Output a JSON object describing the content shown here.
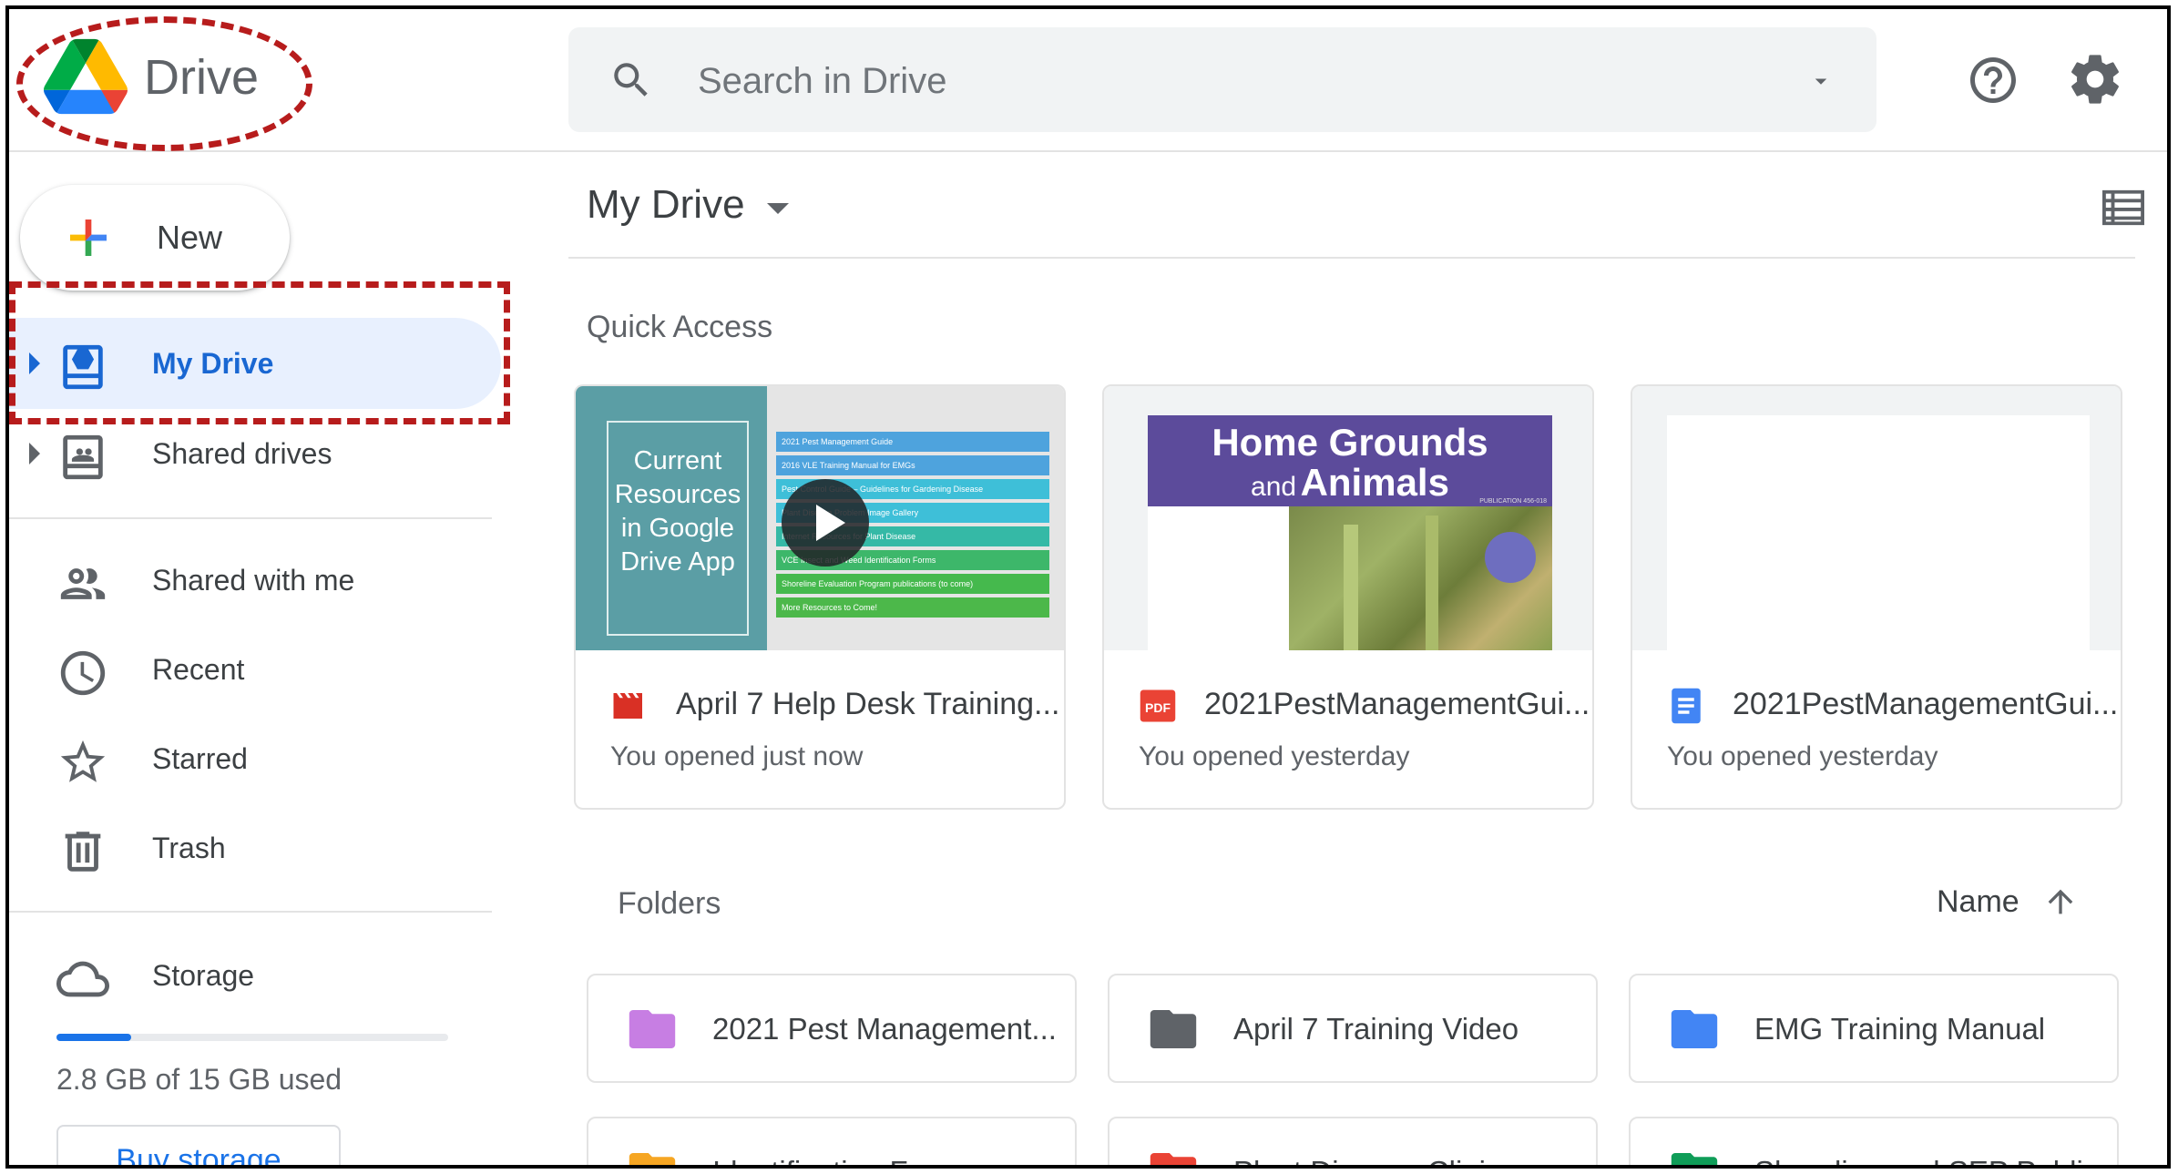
{
  "app": {
    "title": "Drive"
  },
  "search": {
    "placeholder": "Search in Drive"
  },
  "new_button": {
    "label": "New"
  },
  "nav": [
    {
      "label": "My Drive",
      "icon": "my-drive-icon",
      "active": true
    },
    {
      "label": "Shared drives",
      "icon": "shared-drives-icon"
    },
    {
      "label": "Shared with me",
      "icon": "people-icon"
    },
    {
      "label": "Recent",
      "icon": "clock-icon"
    },
    {
      "label": "Starred",
      "icon": "star-icon"
    },
    {
      "label": "Trash",
      "icon": "trash-icon"
    },
    {
      "label": "Storage",
      "icon": "cloud-icon"
    }
  ],
  "storage": {
    "used_text": "2.8 GB of 15 GB used",
    "used_fraction": 0.19,
    "buy_label": "Buy storage"
  },
  "main": {
    "title": "My Drive",
    "quick_access_label": "Quick Access",
    "folders_label": "Folders",
    "sort_label": "Name"
  },
  "quick_access": [
    {
      "name": "April 7 Help Desk Training...",
      "subtitle": "You opened just now",
      "type": "video",
      "thumb_title": "Current Resources in Google Drive App",
      "thumb_items": [
        "2021 Pest Management Guide",
        "2016 VLE Training Manual for EMGs",
        "Pest Control Guide – Guidelines for Gardening Disease",
        "Plant Disease Problem Image Gallery",
        "Internet Resources for Plant Disease",
        "VCE Insect and Weed Identification Forms",
        "Shoreline Evaluation Program publications (to come)",
        "More Resources to Come!"
      ]
    },
    {
      "name": "2021PestManagementGui...",
      "subtitle": "You opened yesterday",
      "type": "pdf",
      "thumb_title_1": "Home Grounds",
      "thumb_title_2a": "and",
      "thumb_title_2b": "Animals",
      "thumb_caption": "PUBLICATION 456-018"
    },
    {
      "name": "2021PestManagementGui...",
      "subtitle": "You opened yesterday",
      "type": "doc"
    }
  ],
  "folders": [
    {
      "name": "2021 Pest Management...",
      "color": "#c77ee3"
    },
    {
      "name": "April 7 Training Video",
      "color": "#5f6368"
    },
    {
      "name": "EMG Training Manual",
      "color": "#4285f4"
    },
    {
      "name": "Identification Forms",
      "color": "#f6a623"
    },
    {
      "name": "Plant Disease Clinic",
      "color": "#ea4335"
    },
    {
      "name": "Shoreline and SEP Publi...",
      "color": "#0f9d58"
    }
  ],
  "colors": {
    "accent": "#1a73e8",
    "active_bg": "#e8f0fe",
    "highlight": "#b71c1c",
    "video": "#d93025",
    "pdf": "#ea4335",
    "doc": "#4285f4"
  }
}
